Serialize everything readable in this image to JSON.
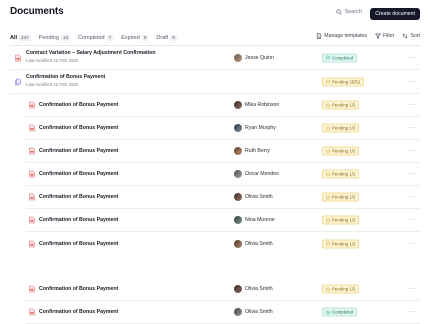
{
  "header": {
    "title": "Documents",
    "search_label": "Search",
    "create_label": "Create document"
  },
  "tabs": [
    {
      "label": "All",
      "count": "247"
    },
    {
      "label": "Pending",
      "count": "13"
    },
    {
      "label": "Completed",
      "count": "7"
    },
    {
      "label": "Expired",
      "count": "0"
    },
    {
      "label": "Draft",
      "count": "0"
    }
  ],
  "toolbar": {
    "manage_templates": "Manage templates",
    "filter": "Filter",
    "sort": "Sort"
  },
  "colors": {
    "pdf_icon": "#e0575b",
    "group_icon": "#7c5ce0",
    "pending": "#f0b429",
    "completed": "#2bb59a"
  },
  "rows": [
    {
      "title": "Contract Variation – Salary Adjustment Confirmation",
      "subtitle": "Last modified 12 Feb 2025",
      "user": "Jesse Quinn",
      "status": "Completed",
      "more": "···"
    },
    {
      "title": "Confirmation of Bonus Payment",
      "subtitle": "Last modified 12 Feb 2025",
      "user": "",
      "status": "Pending 25/52",
      "more": "···"
    },
    {
      "title": "Confirmation of Bonus Payment",
      "user": "Mika Robinson",
      "status": "Pending 1/2",
      "more": "···"
    },
    {
      "title": "Confirmation of Bonus Payment",
      "user": "Ryan Murphy",
      "status": "Pending 1/2",
      "more": "···"
    },
    {
      "title": "Confirmation of Bonus Payment",
      "user": "Ruth Berry",
      "status": "Pending 1/2",
      "more": "···"
    },
    {
      "title": "Confirmation of Bonus Payment",
      "user": "Oscar Mendes",
      "status": "Pending 1/2",
      "more": "···"
    },
    {
      "title": "Confirmation of Bonus Payment",
      "user": "Olivia Smith",
      "status": "Pending 1/2",
      "more": "···"
    },
    {
      "title": "Confirmation of Bonus Payment",
      "user": "Nina Munroe",
      "status": "Pending 1/2",
      "more": "···"
    },
    {
      "title": "Confirmation of Bonus Payment",
      "user": "Olivia Smith",
      "status": "Pending 1/2",
      "more": "···"
    },
    {
      "title": "Confirmation of Bonus Payment",
      "user": "Olivia Smith",
      "status": "Pending 1/2",
      "more": "···"
    },
    {
      "title": "Confirmation of Bonus Payment",
      "user": "Olivia Smith",
      "status": "Completed",
      "more": "···"
    }
  ]
}
